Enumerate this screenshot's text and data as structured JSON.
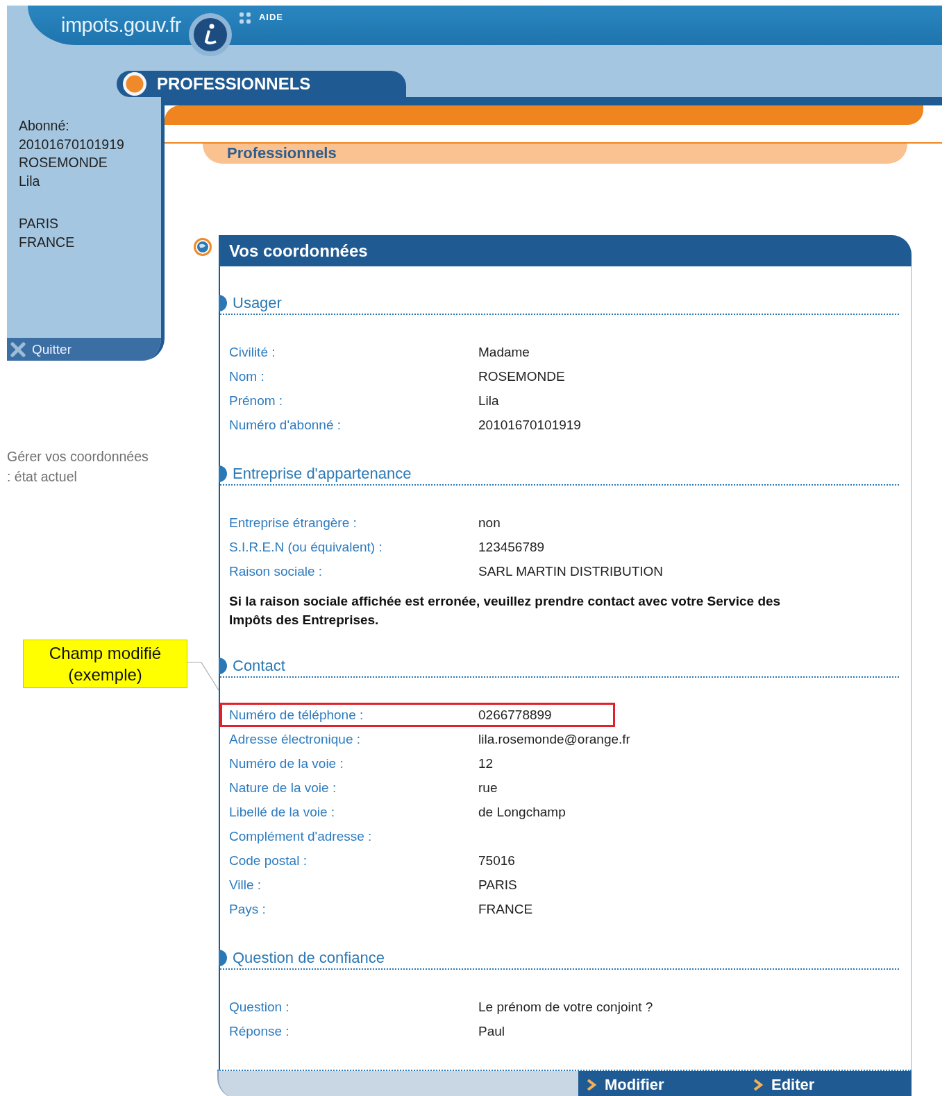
{
  "header": {
    "logo": "impots.gouv.fr",
    "help": "AIDE"
  },
  "space_tab": {
    "label": "PROFESSIONNELS"
  },
  "sidebar": {
    "subscriber_lines": [
      "Abonné:",
      "20101670101919",
      "ROSEMONDE",
      "Lila"
    ],
    "location_lines": [
      "PARIS",
      "FRANCE"
    ],
    "quit": "Quitter",
    "note": "Gérer vos coordonnées : état actuel"
  },
  "sub_tab": {
    "label": "Professionnels"
  },
  "panel": {
    "title": "Vos coordonnées",
    "sections": [
      {
        "title": "Usager",
        "rows": [
          {
            "label": "Civilité :",
            "value": "Madame",
            "highlighted": false
          },
          {
            "label": "Nom :",
            "value": "ROSEMONDE",
            "highlighted": false
          },
          {
            "label": "Prénom :",
            "value": "Lila",
            "highlighted": false
          },
          {
            "label": "Numéro d'abonné :",
            "value": "20101670101919",
            "highlighted": false
          }
        ]
      },
      {
        "title": "Entreprise d'appartenance",
        "rows": [
          {
            "label": "Entreprise étrangère :",
            "value": "non",
            "highlighted": false
          },
          {
            "label": "S.I.R.E.N  (ou équivalent) :",
            "value": "123456789",
            "highlighted": false
          },
          {
            "label": "Raison sociale :",
            "value": "SARL MARTIN DISTRIBUTION",
            "highlighted": false
          }
        ],
        "note": "Si la raison sociale affichée est erronée, veuillez prendre contact avec votre Service des Impôts  des Entreprises."
      },
      {
        "title": "Contact",
        "rows": [
          {
            "label": "Numéro de téléphone :",
            "value": "0266778899",
            "highlighted": true
          },
          {
            "label": "Adresse électronique :",
            "value": "lila.rosemonde@orange.fr",
            "highlighted": false
          },
          {
            "label": "Numéro de la voie :",
            "value": "12",
            "highlighted": false
          },
          {
            "label": "Nature de la voie :",
            "value": "rue",
            "highlighted": false
          },
          {
            "label": "Libellé de la voie :",
            "value": "de Longchamp",
            "highlighted": false
          },
          {
            "label": "Complément d'adresse :",
            "highlighted": false
          },
          {
            "label": "Code postal :",
            "value": "75016",
            "highlighted": false
          },
          {
            "label": "Ville :",
            "value": "PARIS",
            "highlighted": false
          },
          {
            "label": "Pays :",
            "value": "FRANCE",
            "highlighted": false
          }
        ]
      },
      {
        "title": "Question de confiance",
        "rows": [
          {
            "label": "Question :",
            "value": "Le prénom de votre conjoint ?",
            "highlighted": false
          },
          {
            "label": "Réponse :",
            "value": "Paul",
            "highlighted": false
          }
        ]
      }
    ],
    "buttons": [
      "Modifier",
      "Editer"
    ]
  },
  "callout": {
    "text": "Champ modifié (exemple)"
  }
}
